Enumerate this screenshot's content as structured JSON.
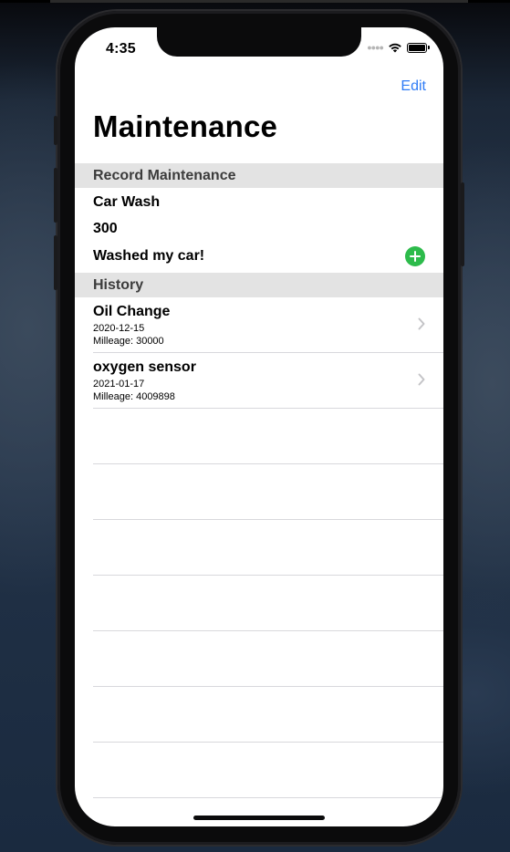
{
  "status_bar": {
    "time": "4:35"
  },
  "nav": {
    "edit_label": "Edit",
    "title": "Maintenance"
  },
  "record_section": {
    "header": "Record Maintenance",
    "service": "Car Wash",
    "mileage": "300",
    "notes": "Washed my car!",
    "add_icon": "plus-circle-fill",
    "add_icon_color": "#2dbb4b"
  },
  "history_section": {
    "header": "History",
    "items": [
      {
        "title": "Oil Change",
        "date": "2020-12-15",
        "mileage": "Milleage: 30000"
      },
      {
        "title": "oxygen sensor",
        "date": "2021-01-17",
        "mileage": "Milleage: 4009898"
      }
    ]
  },
  "colors": {
    "accent": "#2f7cf6",
    "section_header_bg": "#e3e3e3",
    "add_button": "#2dbb4b"
  }
}
